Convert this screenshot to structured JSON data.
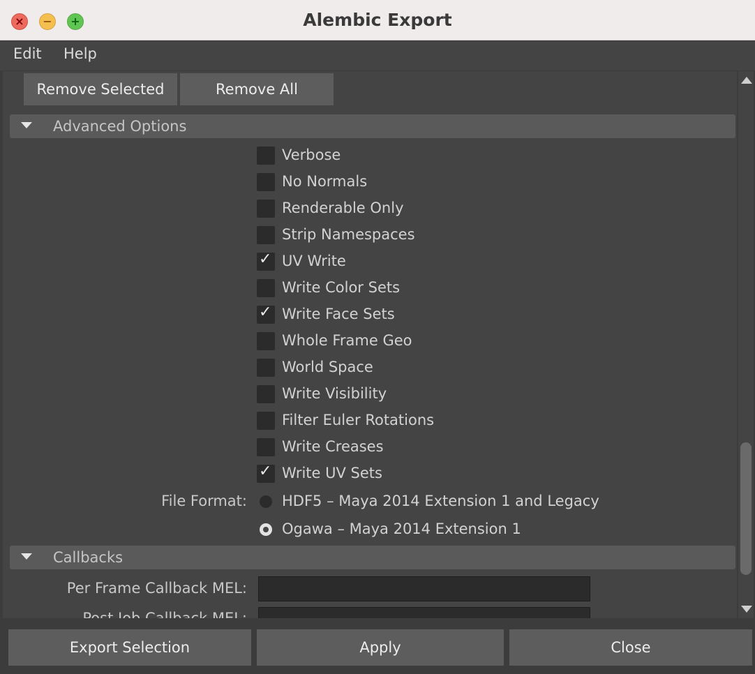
{
  "window": {
    "title": "Alembic Export"
  },
  "menu": {
    "items": [
      "Edit",
      "Help"
    ]
  },
  "buttons": {
    "remove_selected": "Remove Selected",
    "remove_all": "Remove All"
  },
  "advanced": {
    "header": "Advanced Options",
    "options": [
      {
        "label": "Verbose",
        "checked": false
      },
      {
        "label": "No Normals",
        "checked": false
      },
      {
        "label": "Renderable Only",
        "checked": false
      },
      {
        "label": "Strip Namespaces",
        "checked": false
      },
      {
        "label": "UV Write",
        "checked": true
      },
      {
        "label": "Write Color Sets",
        "checked": false
      },
      {
        "label": "Write Face Sets",
        "checked": true
      },
      {
        "label": "Whole Frame Geo",
        "checked": false
      },
      {
        "label": "World Space",
        "checked": false
      },
      {
        "label": "Write Visibility",
        "checked": false
      },
      {
        "label": "Filter Euler Rotations",
        "checked": false
      },
      {
        "label": "Write Creases",
        "checked": false
      },
      {
        "label": "Write UV Sets",
        "checked": true
      }
    ],
    "file_format": {
      "label": "File Format:",
      "options": [
        {
          "label": "HDF5 – Maya 2014 Extension 1 and Legacy",
          "selected": false
        },
        {
          "label": "Ogawa – Maya 2014 Extension 1",
          "selected": true
        }
      ]
    }
  },
  "callbacks": {
    "header": "Callbacks",
    "per_frame_label": "Per Frame Callback MEL:",
    "per_frame_value": "",
    "post_job_label": "Post Job Callback MEL:"
  },
  "footer": {
    "export_selection": "Export Selection",
    "apply": "Apply",
    "close": "Close"
  }
}
